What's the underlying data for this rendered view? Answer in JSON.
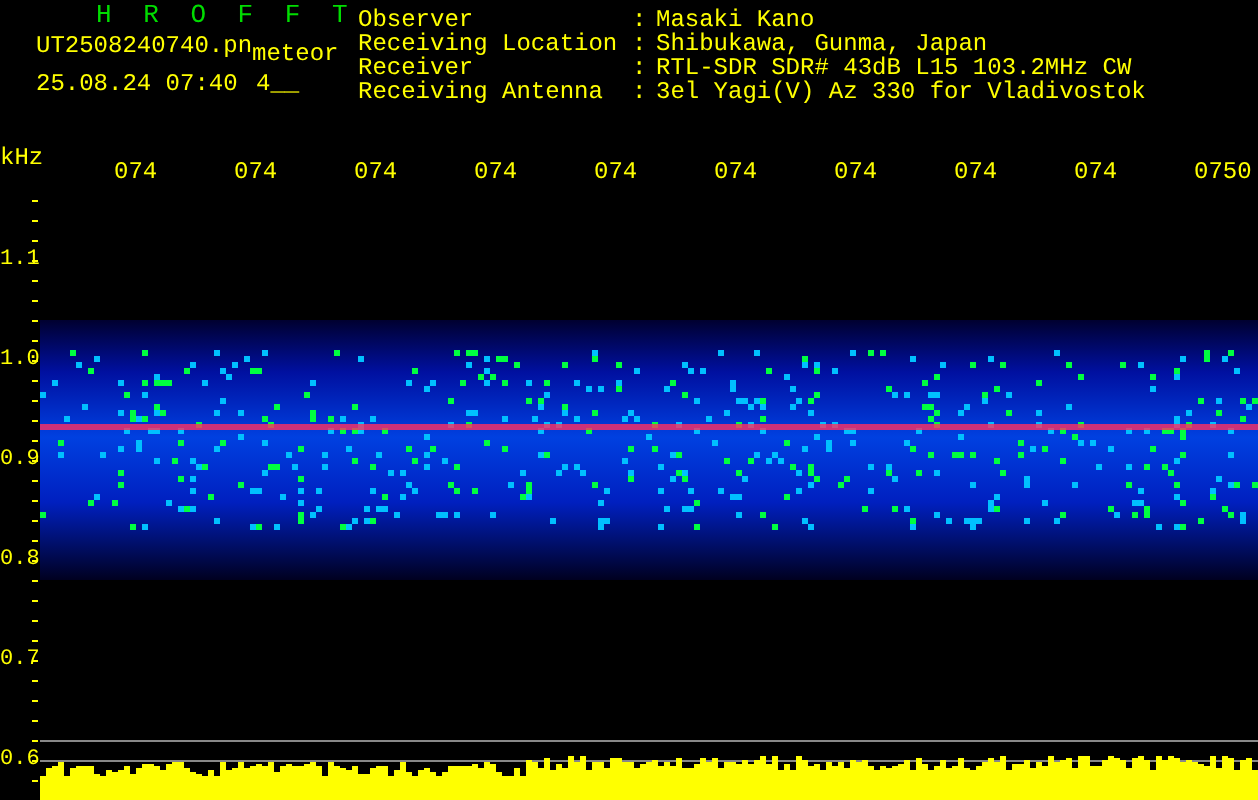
{
  "header": {
    "title": "H R O F F T",
    "filename": "UT2508240740.pn",
    "mode": "meteor",
    "datetime": "25.08.24 07:40",
    "value": "4__"
  },
  "info": [
    {
      "label": "Observer",
      "separator": ":",
      "value": "Masaki Kano"
    },
    {
      "label": "Receiving Location",
      "separator": ":",
      "value": "Shibukawa, Gunma, Japan"
    },
    {
      "label": "Receiver",
      "separator": ":",
      "value": "RTL-SDR SDR# 43dB L15 103.2MHz CW"
    },
    {
      "label": "Receiving Antenna",
      "separator": ":",
      "value": "3el Yagi(V) Az 330 for Vladivostok"
    }
  ],
  "axis": {
    "unit": "kHz",
    "y_labels": [
      "1.1",
      "1.0",
      "0.9",
      "0.8",
      "0.7",
      "0.6"
    ],
    "time_labels": [
      "074",
      "074",
      "074",
      "074",
      "074",
      "074",
      "074",
      "074",
      "074",
      "0750"
    ]
  }
}
